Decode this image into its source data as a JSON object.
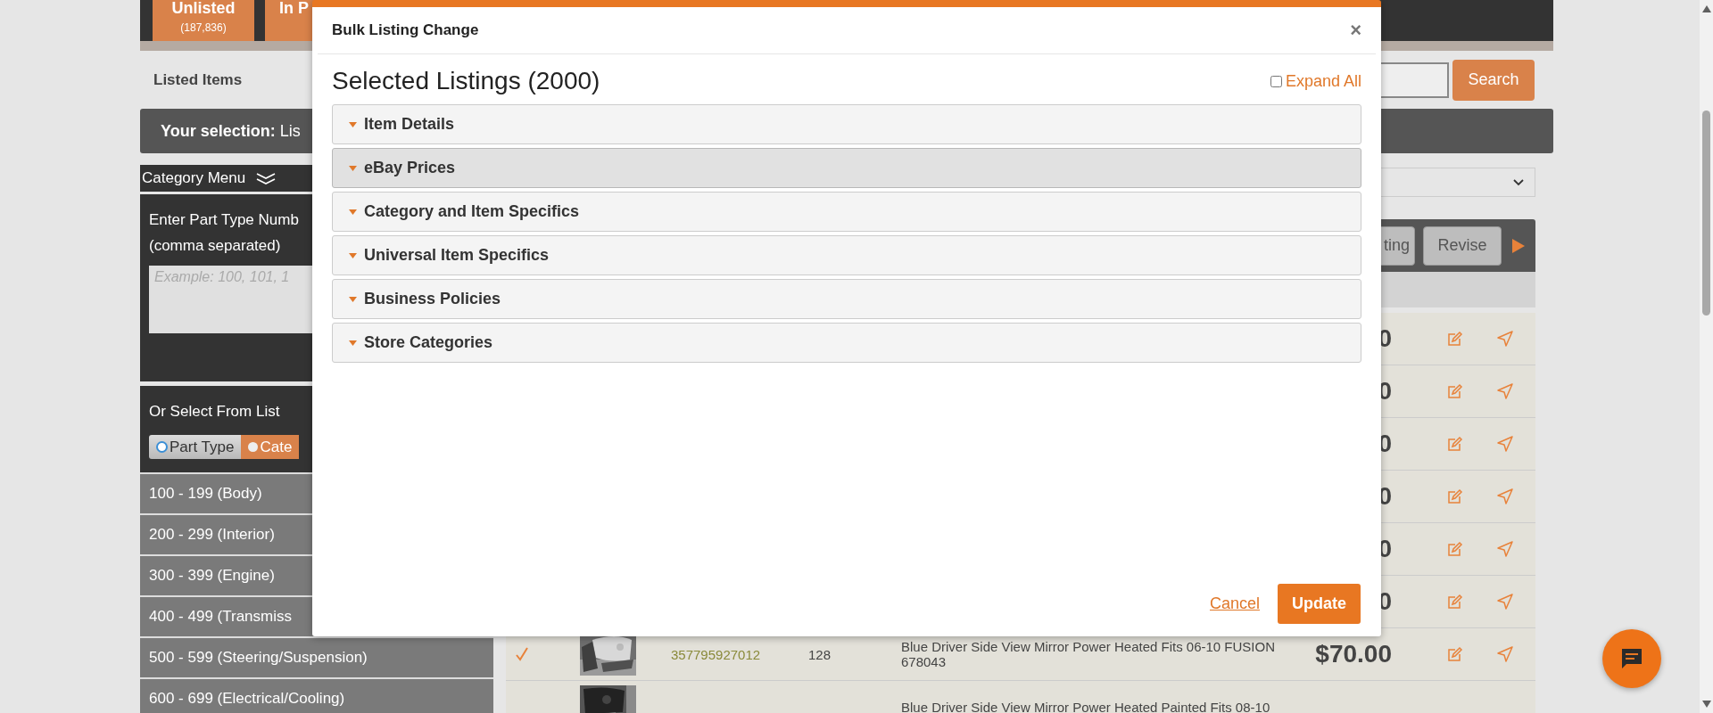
{
  "header": {
    "tabs": [
      {
        "label": "Unlisted",
        "count": "(187,836)"
      },
      {
        "label": "In P"
      }
    ]
  },
  "page_title": "Listed Items",
  "search": {
    "button": "Search"
  },
  "selection_bar": "**Your selection:** Lis",
  "sidebar": {
    "menu_title": "Category Menu",
    "part_input": {
      "label_lines": [
        "Enter Part Type Numb",
        "(comma separated)"
      ],
      "placeholder": "Example: 100, 101, 1"
    },
    "list_heading": "Or Select From List",
    "toggle": [
      {
        "label": "Part Type",
        "selected": true
      },
      {
        "label": "Cate",
        "selected": false
      }
    ],
    "items": [
      "100 - 199 (Body)",
      "200 - 299 (Interior)",
      "300 - 399 (Engine)",
      "400 - 499 (Transmiss",
      "500 - 599 (Steering/Suspension)",
      "600 - 699 (Electrical/Cooling)"
    ]
  },
  "toolbar": {
    "buttons": [
      "ting",
      "Revise"
    ]
  },
  "table": {
    "rows": [
      {
        "kind": "covered",
        "price": "0"
      },
      {
        "kind": "covered",
        "price": "0"
      },
      {
        "kind": "covered",
        "price": "0"
      },
      {
        "kind": "covered",
        "price": "0"
      },
      {
        "kind": "covered",
        "price": "0"
      },
      {
        "kind": "covered",
        "price": "0"
      },
      {
        "kind": "full",
        "checked": true,
        "item_id": "357795927012",
        "quantity": "128",
        "title": "Blue Driver Side View Mirror Power Heated Fits 06-10 FUSION 678043",
        "price": "$70.00"
      },
      {
        "kind": "cut",
        "title": "Blue Driver Side View Mirror Power Heated Painted Fits 08-10"
      }
    ]
  },
  "modal": {
    "title": "Bulk Listing Change",
    "close": "×",
    "heading": "Selected Listings (2000)",
    "expand_all": {
      "label": "Expand All",
      "checked": false
    },
    "sections": [
      {
        "label": "Item Details",
        "highlighted": false
      },
      {
        "label": "eBay Prices",
        "highlighted": true
      },
      {
        "label": "Category and Item Specifics",
        "highlighted": false
      },
      {
        "label": "Universal Item Specifics",
        "highlighted": false
      },
      {
        "label": "Business Policies",
        "highlighted": false
      },
      {
        "label": "Store Categories",
        "highlighted": false
      }
    ],
    "cancel": "Cancel",
    "update": "Update"
  }
}
